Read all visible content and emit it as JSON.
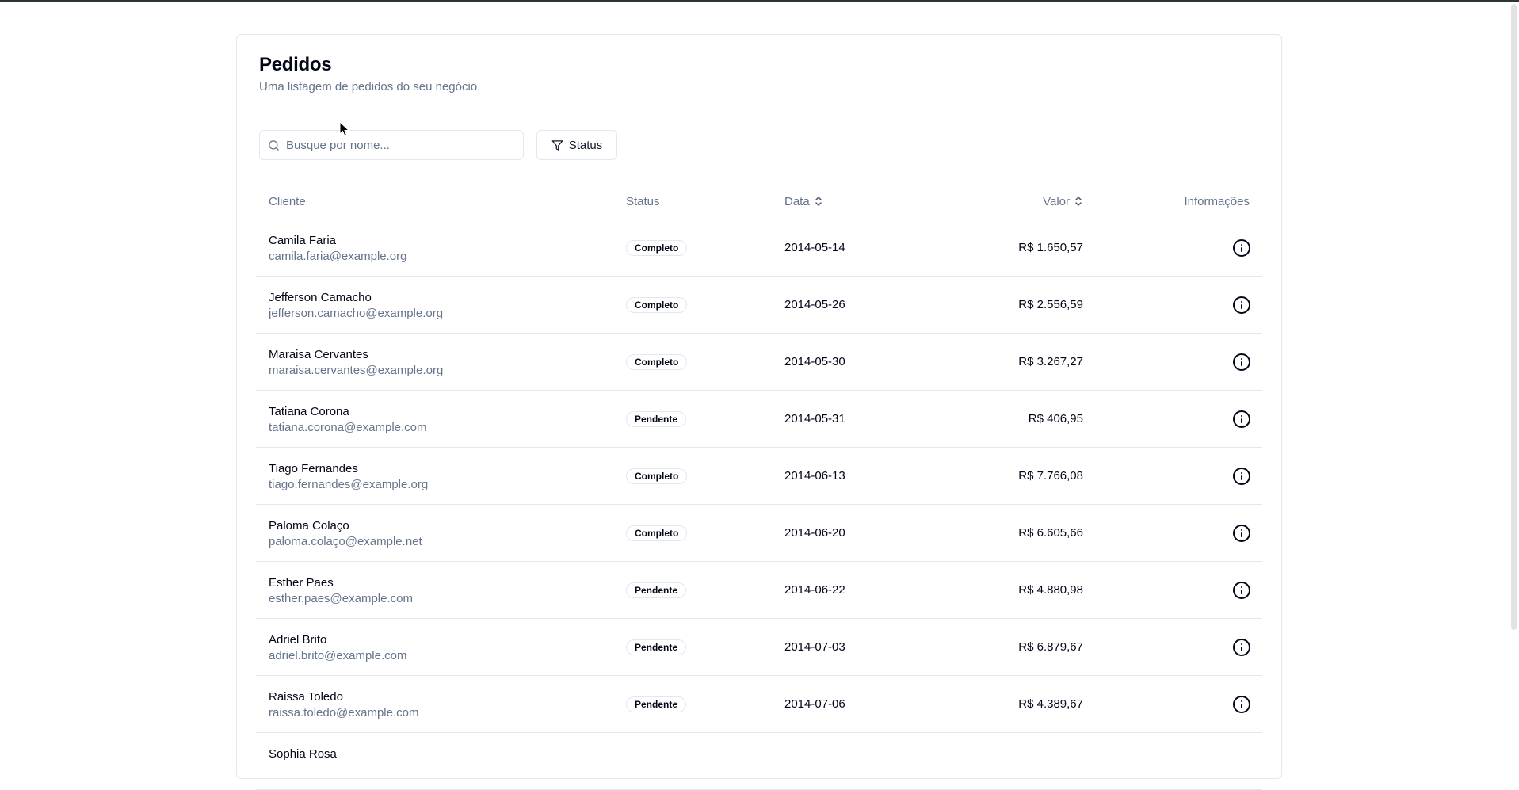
{
  "page": {
    "title": "Pedidos",
    "subtitle": "Uma listagem de pedidos do seu negócio."
  },
  "search": {
    "placeholder": "Busque por nome...",
    "icon": "search-icon"
  },
  "filter": {
    "label": "Status",
    "icon": "filter-icon"
  },
  "table": {
    "headers": {
      "client": "Cliente",
      "status": "Status",
      "date": "Data",
      "value": "Valor",
      "info": "Informações"
    },
    "rows": [
      {
        "name": "Camila Faria",
        "email": "camila.faria@example.org",
        "status": "Completo",
        "date": "2014-05-14",
        "value": "R$ 1.650,57"
      },
      {
        "name": "Jefferson Camacho",
        "email": "jefferson.camacho@example.org",
        "status": "Completo",
        "date": "2014-05-26",
        "value": "R$ 2.556,59"
      },
      {
        "name": "Maraisa Cervantes",
        "email": "maraisa.cervantes@example.org",
        "status": "Completo",
        "date": "2014-05-30",
        "value": "R$ 3.267,27"
      },
      {
        "name": "Tatiana Corona",
        "email": "tatiana.corona@example.com",
        "status": "Pendente",
        "date": "2014-05-31",
        "value": "R$ 406,95"
      },
      {
        "name": "Tiago Fernandes",
        "email": "tiago.fernandes@example.org",
        "status": "Completo",
        "date": "2014-06-13",
        "value": "R$ 7.766,08"
      },
      {
        "name": "Paloma Colaço",
        "email": "paloma.colaço@example.net",
        "status": "Completo",
        "date": "2014-06-20",
        "value": "R$ 6.605,66"
      },
      {
        "name": "Esther Paes",
        "email": "esther.paes@example.com",
        "status": "Pendente",
        "date": "2014-06-22",
        "value": "R$ 4.880,98"
      },
      {
        "name": "Adriel Brito",
        "email": "adriel.brito@example.com",
        "status": "Pendente",
        "date": "2014-07-03",
        "value": "R$ 6.879,67"
      },
      {
        "name": "Raissa Toledo",
        "email": "raissa.toledo@example.com",
        "status": "Pendente",
        "date": "2014-07-06",
        "value": "R$ 4.389,67"
      },
      {
        "name": "Sophia Rosa",
        "email": "",
        "status": "",
        "date": "",
        "value": ""
      }
    ]
  },
  "colors": {
    "text_primary": "#020617",
    "text_muted": "#64748b",
    "border": "#e2e8f0",
    "topbar": "#2b3437"
  }
}
